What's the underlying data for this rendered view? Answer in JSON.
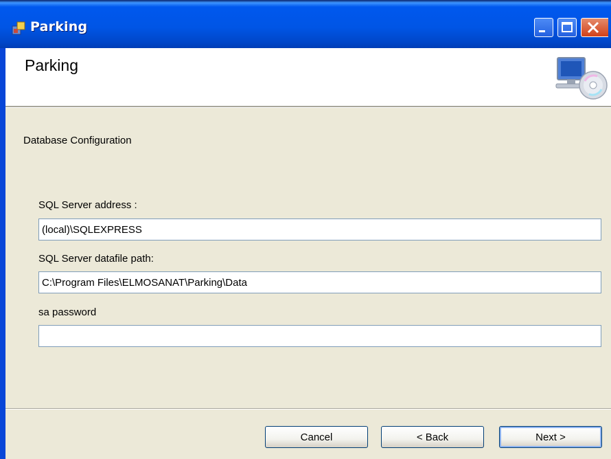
{
  "window": {
    "title": "Parking"
  },
  "banner": {
    "title": "Parking",
    "icon": "computer-cd-icon"
  },
  "section": {
    "title": "Database Configuration"
  },
  "fields": {
    "server_address": {
      "label": "SQL Server address :",
      "value": "(local)\\SQLEXPRESS"
    },
    "datafile_path": {
      "label": "SQL Server datafile path:",
      "value": "C:\\Program Files\\ELMOSANAT\\Parking\\Data"
    },
    "sa_password": {
      "label": "sa password",
      "value": ""
    }
  },
  "buttons": {
    "cancel": "Cancel",
    "back": "< Back",
    "next": "Next >"
  },
  "colors": {
    "titlebar": "#0055E5",
    "dialog_bg": "#ECE9D8",
    "close_button": "#D2411A",
    "frame_accent": "#0846D8"
  }
}
